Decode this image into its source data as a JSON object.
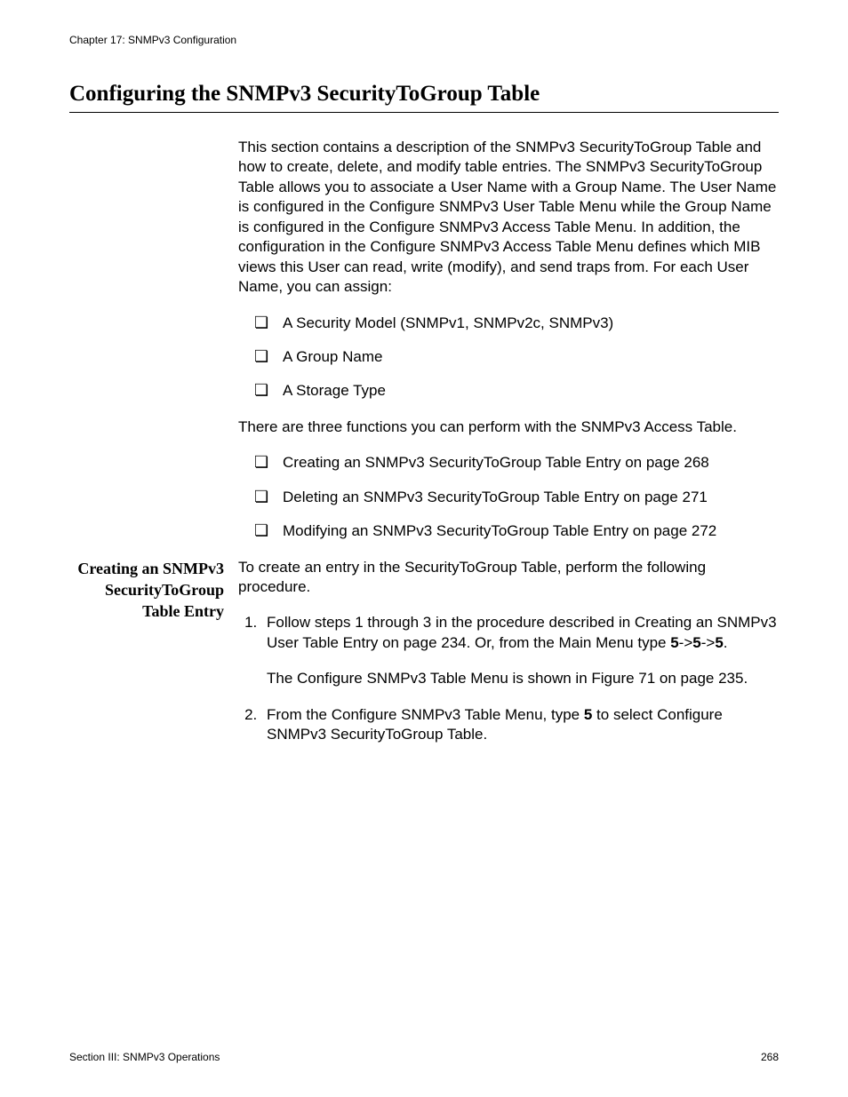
{
  "header": {
    "chapter": "Chapter 17: SNMPv3 Configuration"
  },
  "title": "Configuring the SNMPv3 SecurityToGroup Table",
  "intro": {
    "para1": "This section contains a description of the SNMPv3 SecurityToGroup Table and how to create, delete, and modify table entries. The SNMPv3 SecurityToGroup Table allows you to associate a User Name with a Group Name. The User Name is configured in the Configure SNMPv3 User Table Menu while the Group Name is configured in the Configure SNMPv3 Access Table Menu. In addition, the configuration in the Configure SNMPv3 Access Table Menu defines which MIB views this User can read, write (modify), and send traps from. For each User Name, you can assign:",
    "bullets1": [
      "A Security Model (SNMPv1, SNMPv2c, SNMPv3)",
      "A Group Name",
      "A Storage Type"
    ],
    "para2": "There are three functions you can perform with the SNMPv3 Access Table.",
    "bullets2": [
      "Creating an SNMPv3 SecurityToGroup Table Entry on page 268",
      "Deleting an SNMPv3 SecurityToGroup Table Entry on page 271",
      "Modifying an SNMPv3 SecurityToGroup Table Entry on page 272"
    ]
  },
  "subsection": {
    "heading": "Creating an SNMPv3 SecurityToGroup Table Entry",
    "lead": "To create an entry in the SecurityToGroup Table, perform the following procedure.",
    "step1_a": "Follow steps 1 through 3 in the procedure described in Creating an SNMPv3 User Table Entry on page 234. Or, from the Main Menu type ",
    "step1_b": "5",
    "step1_c": "->",
    "step1_d": "5",
    "step1_e": "->",
    "step1_f": "5",
    "step1_g": ".",
    "step1_extra": "The Configure SNMPv3 Table Menu is shown in Figure 71 on page 235.",
    "step2_a": "From the Configure SNMPv3 Table Menu, type ",
    "step2_b": "5",
    "step2_c": " to select Configure SNMPv3 SecurityToGroup Table."
  },
  "footer": {
    "left": "Section III: SNMPv3 Operations",
    "right": "268"
  }
}
